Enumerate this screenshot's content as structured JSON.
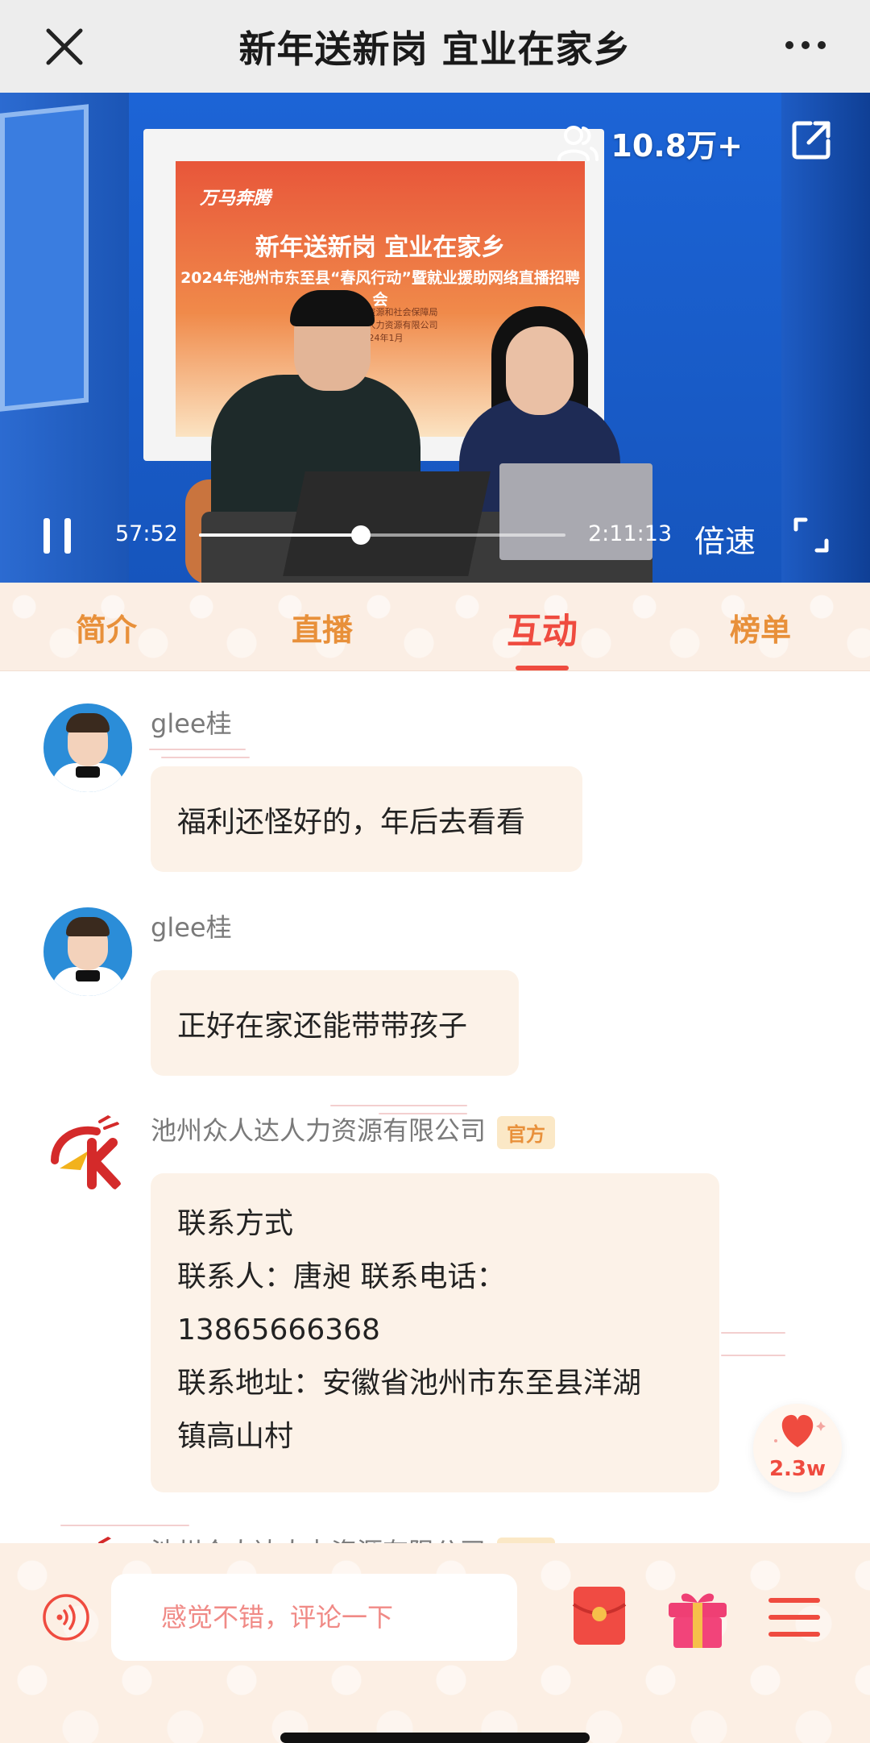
{
  "header": {
    "title": "新年送新岗 宜业在家乡",
    "close_icon": "close-icon",
    "more_icon": "more-icon"
  },
  "video": {
    "poster": {
      "logo_text": "万马奔腾",
      "line1": "新年送新岗  宜业在家乡",
      "line2": "2024年池州市东至县“春风行动”暨就业援助网络直播招聘会",
      "organizer1": "东至县人力资源和社会保障局",
      "organizer2": "池州众人达人力资源有限公司",
      "date": "2024年1月"
    },
    "viewers": "10.8万+",
    "current_time": "57:52",
    "total_time": "2:11:13",
    "progress_fraction": 0.442,
    "speed_label": "倍速"
  },
  "tabs": [
    {
      "label": "简介",
      "active": false
    },
    {
      "label": "直播",
      "active": false
    },
    {
      "label": "互动",
      "active": true
    },
    {
      "label": "榜单",
      "active": false
    }
  ],
  "messages": [
    {
      "user": "glee桂",
      "text": "福利还怪好的，年后去看看",
      "official": false
    },
    {
      "user": "glee桂",
      "text": "正好在家还能带带孩子",
      "official": false
    },
    {
      "user": "池州众人达人力资源有限公司",
      "official_badge": "官方",
      "lines": [
        "联系方式",
        "联系人：唐昶 联系电话：",
        "13865666368",
        "联系地址：安徽省池州市东至县洋湖",
        "镇高山村"
      ]
    },
    {
      "user": "池州众人达人力资源有限公司",
      "official_badge": "官方"
    }
  ],
  "like": {
    "count": "2.3w"
  },
  "bottom_bar": {
    "comment_placeholder": "感觉不错，评论一下"
  },
  "colors": {
    "accent": "#ef4b3f",
    "tab_inactive": "#e8903a",
    "bubble_bg": "#fcf2e8"
  }
}
